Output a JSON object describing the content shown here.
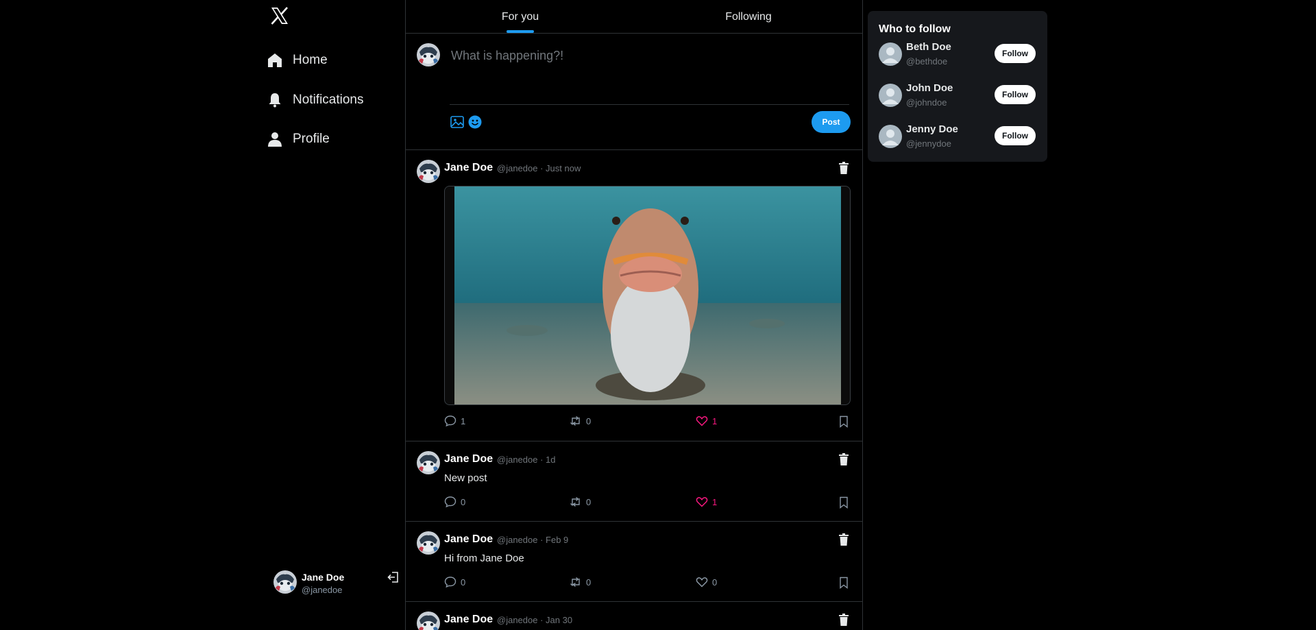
{
  "sidebar": {
    "logo_icon": "x-logo-icon",
    "nav": [
      {
        "label": "Home",
        "icon": "home-icon"
      },
      {
        "label": "Notifications",
        "icon": "bell-icon"
      },
      {
        "label": "Profile",
        "icon": "person-icon"
      }
    ],
    "account": {
      "name": "Jane Doe",
      "handle": "@janedoe",
      "logout_icon": "logout-icon"
    }
  },
  "tabs": [
    {
      "label": "For you",
      "active": true
    },
    {
      "label": "Following",
      "active": false
    }
  ],
  "compose": {
    "placeholder": "What is happening?!",
    "value": "",
    "post_label": "Post",
    "icons": [
      "image-icon",
      "emoji-icon"
    ]
  },
  "colors": {
    "accent": "#1d9bf0",
    "like": "#f91880",
    "background": "#000000",
    "panel": "#16181c"
  },
  "posts": [
    {
      "name": "Jane Doe",
      "handle": "@janedoe",
      "time": "Just now",
      "text": "",
      "has_media": true,
      "replies": "1",
      "reposts": "0",
      "likes": "1",
      "liked": true
    },
    {
      "name": "Jane Doe",
      "handle": "@janedoe",
      "time": "1d",
      "text": "New post",
      "has_media": false,
      "replies": "0",
      "reposts": "0",
      "likes": "1",
      "liked": true
    },
    {
      "name": "Jane Doe",
      "handle": "@janedoe",
      "time": "Feb 9",
      "text": "Hi from Jane Doe",
      "has_media": false,
      "replies": "0",
      "reposts": "0",
      "likes": "0",
      "liked": false
    },
    {
      "name": "Jane Doe",
      "handle": "@janedoe",
      "time": "Jan 30"
    }
  ],
  "who_to_follow": {
    "title": "Who to follow",
    "follow_label": "Follow",
    "users": [
      {
        "name": "Beth Doe",
        "handle": "@bethdoe"
      },
      {
        "name": "John Doe",
        "handle": "@johndoe"
      },
      {
        "name": "Jenny Doe",
        "handle": "@jennydoe"
      }
    ]
  }
}
